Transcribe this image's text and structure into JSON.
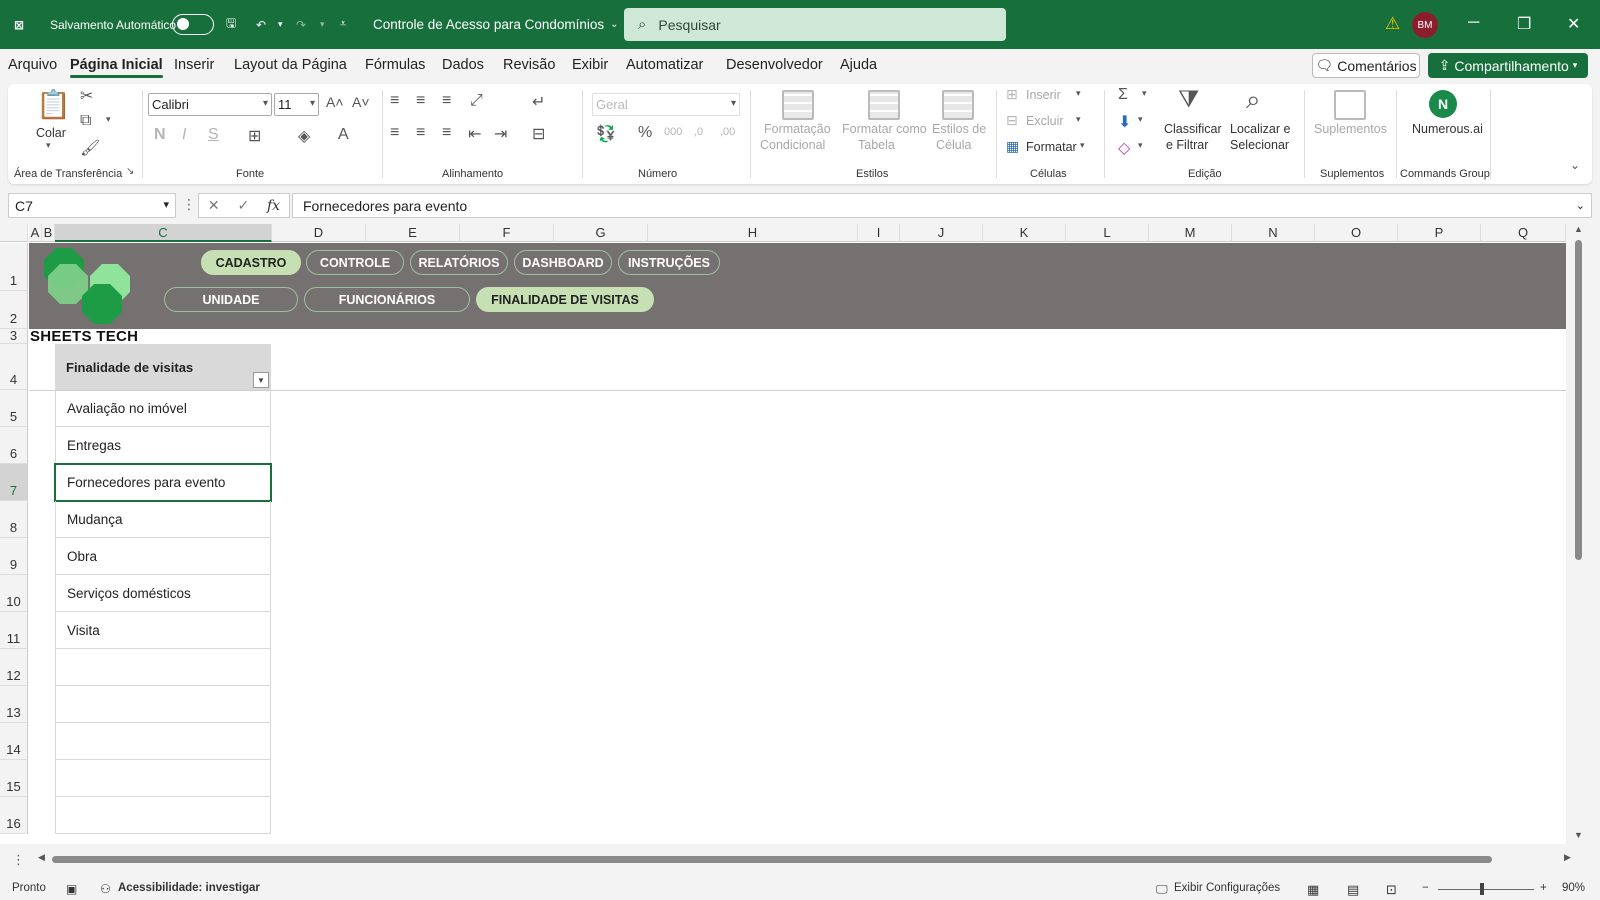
{
  "titlebar": {
    "autosave_label": "Salvamento Automático",
    "doc_title": "Controle de Acesso para Condomínios",
    "search_placeholder": "Pesquisar",
    "avatar": "BM"
  },
  "menu": {
    "tabs": [
      "Arquivo",
      "Página Inicial",
      "Inserir",
      "Layout da Página",
      "Fórmulas",
      "Dados",
      "Revisão",
      "Exibir",
      "Automatizar",
      "Desenvolvedor",
      "Ajuda"
    ],
    "active_index": 1,
    "comments": "Comentários",
    "share": "Compartilhamento"
  },
  "ribbon": {
    "clipboard": {
      "paste": "Colar",
      "label": "Área de Transferência"
    },
    "font": {
      "name": "Calibri",
      "size": "11",
      "label": "Fonte"
    },
    "alignment": {
      "label": "Alinhamento"
    },
    "number": {
      "format": "Geral",
      "label": "Número"
    },
    "styles": {
      "conditional_1": "Formatação",
      "conditional_2": "Condicional",
      "table_1": "Formatar como",
      "table_2": "Tabela",
      "cellstyles_1": "Estilos de",
      "cellstyles_2": "Célula",
      "label": "Estilos"
    },
    "cells": {
      "insert": "Inserir",
      "delete": "Excluir",
      "format": "Formatar",
      "label": "Células"
    },
    "editing": {
      "sort_1": "Classificar",
      "sort_2": "e Filtrar",
      "find_1": "Localizar e",
      "find_2": "Selecionar",
      "label": "Edição"
    },
    "addins": {
      "button": "Suplementos",
      "label": "Suplementos"
    },
    "commands": {
      "button": "Numerous.ai",
      "label": "Commands Group"
    }
  },
  "formula_bar": {
    "name_box": "C7",
    "fx": "fx",
    "content": "Fornecedores para evento"
  },
  "sheet": {
    "columns": [
      "A",
      "B",
      "C",
      "D",
      "E",
      "F",
      "G",
      "H",
      "I",
      "J",
      "K",
      "L",
      "M",
      "N",
      "O",
      "P",
      "Q"
    ],
    "rows": [
      "1",
      "2",
      "3",
      "4",
      "5",
      "6",
      "7",
      "8",
      "9",
      "10",
      "11",
      "12",
      "13",
      "14",
      "15",
      "16"
    ],
    "nav_top": [
      "CADASTRO",
      "CONTROLE",
      "RELATÓRIOS",
      "DASHBOARD",
      "INSTRUÇÕES"
    ],
    "nav_bottom": [
      "UNIDADE",
      "FUNCIONÁRIOS",
      "FINALIDADE DE VISITAS"
    ],
    "brand": "SHEETS TECH",
    "table_header": "Finalidade de visitas",
    "items": [
      "Avaliação no imóvel",
      "Entregas",
      "Fornecedores para evento",
      "Mudança",
      "Obra",
      "Serviços domésticos",
      "Visita",
      "",
      "",
      "",
      "",
      ""
    ],
    "colors": {
      "banner": "#767171",
      "pill_active": "#c6e0b4",
      "accent": "#17703c"
    }
  },
  "statusbar": {
    "ready": "Pronto",
    "accessibility": "Acessibilidade: investigar",
    "display_settings": "Exibir Configurações",
    "zoom": "90%"
  }
}
